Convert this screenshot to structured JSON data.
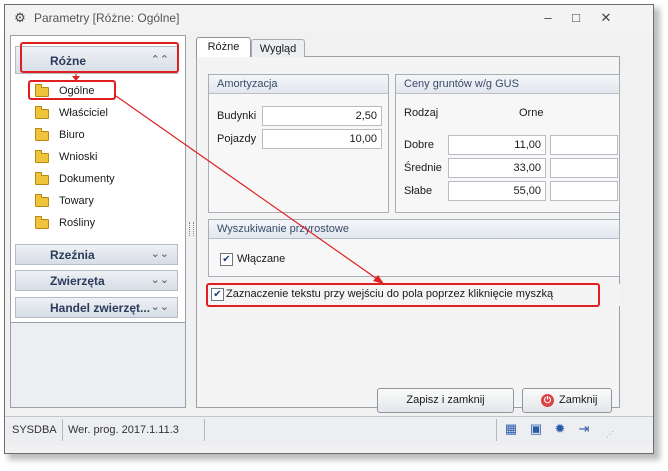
{
  "window": {
    "title": "Parametry [Różne: Ogólne]",
    "app_icon": "gear-icon",
    "controls": {
      "minimize": "–",
      "maximize": "□",
      "close": "✕"
    }
  },
  "nav": {
    "groups": [
      {
        "label": "Różne",
        "chevron": "⌃⌃",
        "expanded": true
      },
      {
        "label": "Rzeźnia",
        "chevron": "⌄⌄",
        "expanded": false
      },
      {
        "label": "Zwierzęta",
        "chevron": "⌄⌄",
        "expanded": false
      },
      {
        "label": "Handel zwierzęt...",
        "chevron": "⌄⌄",
        "expanded": false
      }
    ],
    "items": [
      {
        "label": "Ogólne",
        "selected": true
      },
      {
        "label": "Właściciel"
      },
      {
        "label": "Biuro"
      },
      {
        "label": "Wnioski"
      },
      {
        "label": "Dokumenty"
      },
      {
        "label": "Towary"
      },
      {
        "label": "Rośliny"
      }
    ]
  },
  "tabs": [
    {
      "label": "Różne",
      "active": true
    },
    {
      "label": "Wygląd",
      "active": false
    }
  ],
  "amortyzacja": {
    "title": "Amortyzacja",
    "rows": [
      {
        "label": "Budynki",
        "value": "2,50"
      },
      {
        "label": "Pojazdy",
        "value": "10,00"
      }
    ]
  },
  "ceny": {
    "title": "Ceny gruntów w/g GUS",
    "col_rodzaj": "Rodzaj",
    "col_orne": "Orne",
    "rows": [
      {
        "label": "Dobre",
        "value": "11,00"
      },
      {
        "label": "Średnie",
        "value": "33,00"
      },
      {
        "label": "Słabe",
        "value": "55,00"
      }
    ]
  },
  "wyszukiwanie": {
    "title": "Wyszukiwanie przyrostowe",
    "checkbox_label": "Włączane",
    "checked": true
  },
  "zaznaczenie": {
    "checkbox_label": "Zaznaczenie tekstu przy wejściu do pola poprzez kliknięcie myszką",
    "checked": true
  },
  "buttons": {
    "save": "Zapisz i zamknij",
    "close": "Zamknij"
  },
  "statusbar": {
    "user": "SYSDBA",
    "version": "Wer. prog. 2017.1.11.3",
    "icons": [
      "calculator-icon",
      "save-icon",
      "settings-icon",
      "exit-icon"
    ]
  },
  "annotation_color": "#e02020"
}
